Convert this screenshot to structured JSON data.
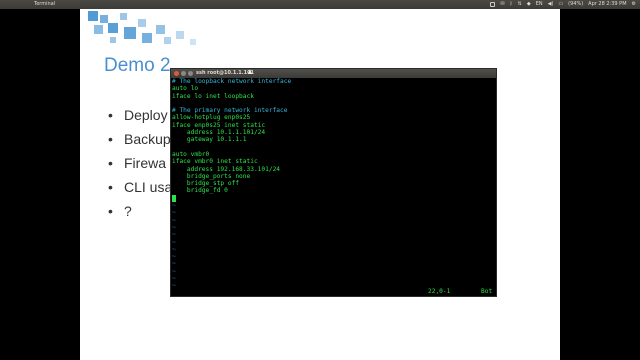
{
  "top_panel": {
    "app_title": "Terminal",
    "battery": "(94%)",
    "clock": "Apr 28  2:39 PM"
  },
  "slide": {
    "title": "Demo 2",
    "bullets": [
      "Deploy",
      "Backup",
      "Firewa",
      "CLI usa",
      "?"
    ]
  },
  "terminal": {
    "title": "ssh root@10.1.1.101",
    "lines": [
      {
        "text": "# The loopback network interface",
        "kind": "comment"
      },
      {
        "text": "auto lo",
        "kind": "text"
      },
      {
        "text": "iface lo inet loopback",
        "kind": "text"
      },
      {
        "text": "",
        "kind": "text"
      },
      {
        "text": "# The primary network interface",
        "kind": "comment"
      },
      {
        "text": "allow-hotplug enp0s25",
        "kind": "text"
      },
      {
        "text": "iface enp0s25 inet static",
        "kind": "text"
      },
      {
        "text": "    address 10.1.1.101/24",
        "kind": "text"
      },
      {
        "text": "    gateway 10.1.1.1",
        "kind": "text"
      },
      {
        "text": "",
        "kind": "text"
      },
      {
        "text": "auto vmbr0",
        "kind": "text"
      },
      {
        "text": "iface vmbr0 inet static",
        "kind": "text"
      },
      {
        "text": "    address 192.168.33.101/24",
        "kind": "text"
      },
      {
        "text": "    bridge_ports none",
        "kind": "text"
      },
      {
        "text": "    bridge_stp off",
        "kind": "text"
      },
      {
        "text": "    bridge_fd 0",
        "kind": "text"
      },
      {
        "text": "",
        "kind": "cursor"
      },
      {
        "text": "~",
        "kind": "tilde"
      },
      {
        "text": "~",
        "kind": "tilde"
      },
      {
        "text": "~",
        "kind": "tilde"
      },
      {
        "text": "~",
        "kind": "tilde"
      },
      {
        "text": "~",
        "kind": "tilde"
      },
      {
        "text": "~",
        "kind": "tilde"
      },
      {
        "text": "~",
        "kind": "tilde"
      },
      {
        "text": "~",
        "kind": "tilde"
      },
      {
        "text": "~",
        "kind": "tilde"
      },
      {
        "text": "~",
        "kind": "tilde"
      },
      {
        "text": "~",
        "kind": "tilde"
      },
      {
        "text": "~",
        "kind": "tilde"
      }
    ],
    "status_pos": "22,0-1",
    "status_where": "Bot"
  },
  "colors": {
    "slide_accent": "#4a90d0",
    "term_green": "#2ee24a",
    "term_comment": "#38b4d6",
    "term_tilde": "#2a7cd8"
  }
}
